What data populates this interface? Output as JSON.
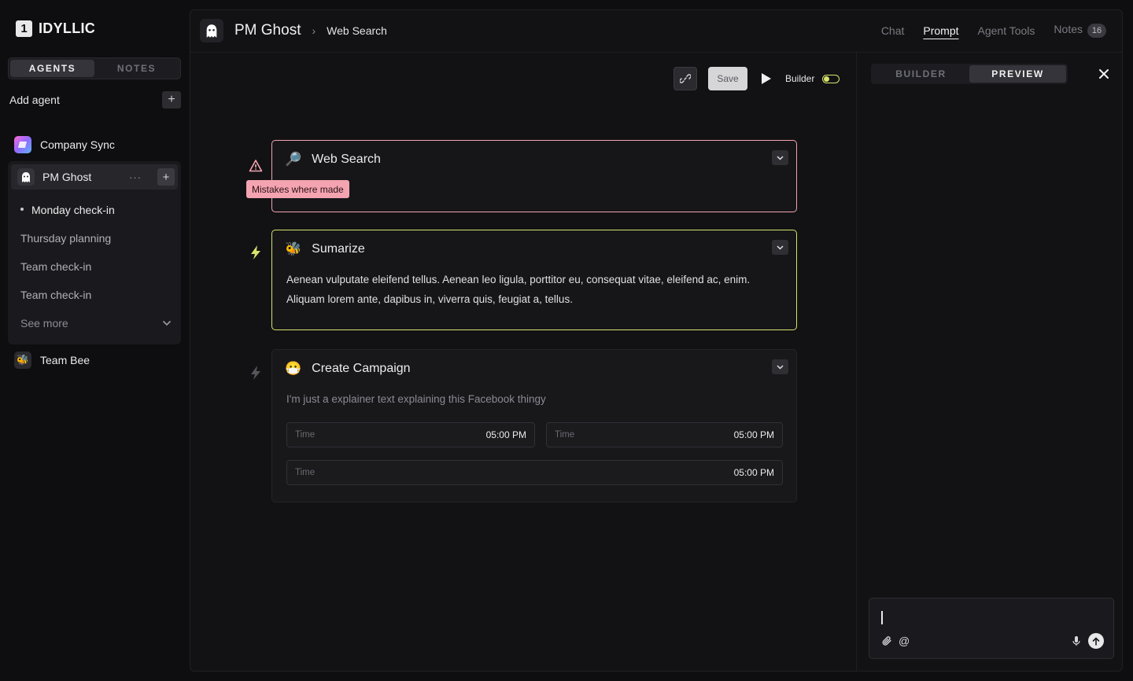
{
  "app": {
    "logo_mark": "1",
    "logo_text": "IDYLLIC"
  },
  "sidebar": {
    "tabs": [
      {
        "label": "AGENTS",
        "active": true
      },
      {
        "label": "NOTES",
        "active": false
      }
    ],
    "add_agent_label": "Add agent",
    "add_agent_icon": "+",
    "agents": [
      {
        "name": "Company Sync",
        "icon": "gradient-square-icon"
      },
      {
        "name": "PM Ghost",
        "icon": "ghost-icon"
      },
      {
        "name": "Team Bee",
        "icon": "bee-emoji-icon",
        "emoji": "🐝"
      }
    ],
    "pm_ghost": {
      "dots": "···",
      "plus": "+",
      "sessions": [
        "Monday check-in",
        "Thursday planning",
        "Team check-in",
        "Team check-in"
      ],
      "see_more": "See more"
    }
  },
  "header": {
    "title": "PM Ghost",
    "separator": "›",
    "subtitle": "Web Search",
    "tabs": [
      "Chat",
      "Prompt",
      "Agent Tools",
      "Notes"
    ],
    "active_tab": "Prompt",
    "notes_count": "16"
  },
  "toolbar": {
    "save_label": "Save",
    "builder_label": "Builder",
    "builder_on": true
  },
  "cards": [
    {
      "title": "Web Search",
      "emoji": "🔎",
      "tooltip": "Mistakes where made",
      "border": "#f4a3b1"
    },
    {
      "title": "Sumarize",
      "emoji": "🐝",
      "body": "Aenean vulputate eleifend tellus. Aenean leo ligula, porttitor eu, consequat vitae, eleifend ac, enim. Aliquam lorem ante, dapibus in, viverra quis, feugiat a, tellus.",
      "border": "#d8e36b"
    },
    {
      "title": "Create Campaign",
      "emoji": "😷",
      "body": "I'm just a explainer text explaining this Facebook thingy",
      "fields": [
        {
          "placeholder": "Time",
          "value": "05:00 PM"
        },
        {
          "placeholder": "Time",
          "value": "05:00 PM"
        },
        {
          "placeholder": "Time",
          "value": "05:00 PM"
        }
      ]
    }
  ],
  "preview": {
    "tabs": [
      {
        "label": "BUILDER",
        "active": false
      },
      {
        "label": "PREVIEW",
        "active": true
      }
    ],
    "composer_icons": {
      "attach": "paperclip-icon",
      "mention": "@"
    }
  },
  "colors": {
    "accent_yellow": "#d8e36b",
    "error_pink": "#f4a3b1"
  }
}
